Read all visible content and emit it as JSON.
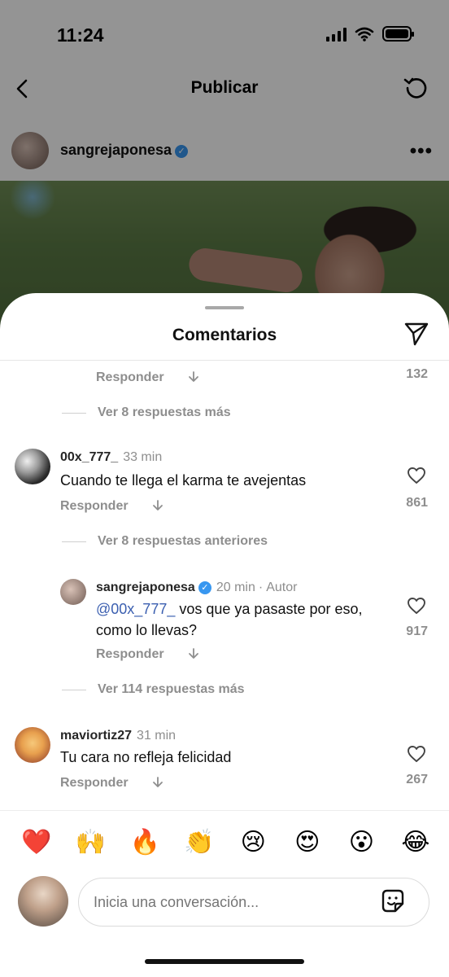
{
  "status_bar": {
    "time": "11:24"
  },
  "header": {
    "title": "Publicar"
  },
  "post": {
    "username": "sangrejaponesa",
    "verified": true
  },
  "sheet": {
    "title": "Comentarios",
    "top_reply": {
      "action": "Responder",
      "likes": "132",
      "more_replies": "Ver 8 respuestas más"
    },
    "comments": [
      {
        "username": "00x_777_",
        "time": "33 min",
        "text": "Cuando te llega el karma te avejentas",
        "action": "Responder",
        "likes": "861",
        "previous_replies": "Ver 8 respuestas anteriores"
      },
      {
        "username": "sangrejaponesa",
        "verified": true,
        "time": "20 min",
        "author_tag": "Autor",
        "mention": "@00x_777_",
        "text": "vos que ya pasaste por eso, como lo llevas?",
        "action": "Responder",
        "likes": "917",
        "more_replies": "Ver 114 respuestas más"
      },
      {
        "username": "maviortiz27",
        "time": "31 min",
        "text": "Tu cara no refleja felicidad",
        "action": "Responder",
        "likes": "267"
      }
    ],
    "emojis": [
      "❤️",
      "🙌",
      "🔥",
      "👏",
      "😢",
      "😍",
      "😮",
      "😂"
    ],
    "input": {
      "placeholder": "Inicia una conversación..."
    }
  },
  "icons": {
    "back": "back-arrow-icon",
    "refresh": "refresh-icon",
    "more": "more-dots-icon",
    "share": "share-paper-plane-icon",
    "heart": "heart-outline-icon",
    "reply_arrow": "arrow-down-icon",
    "sticker": "sticker-icon"
  },
  "colors": {
    "verified": "#3897f0",
    "mention": "#3b5fb0",
    "secondary_text": "#8e8e8e"
  }
}
